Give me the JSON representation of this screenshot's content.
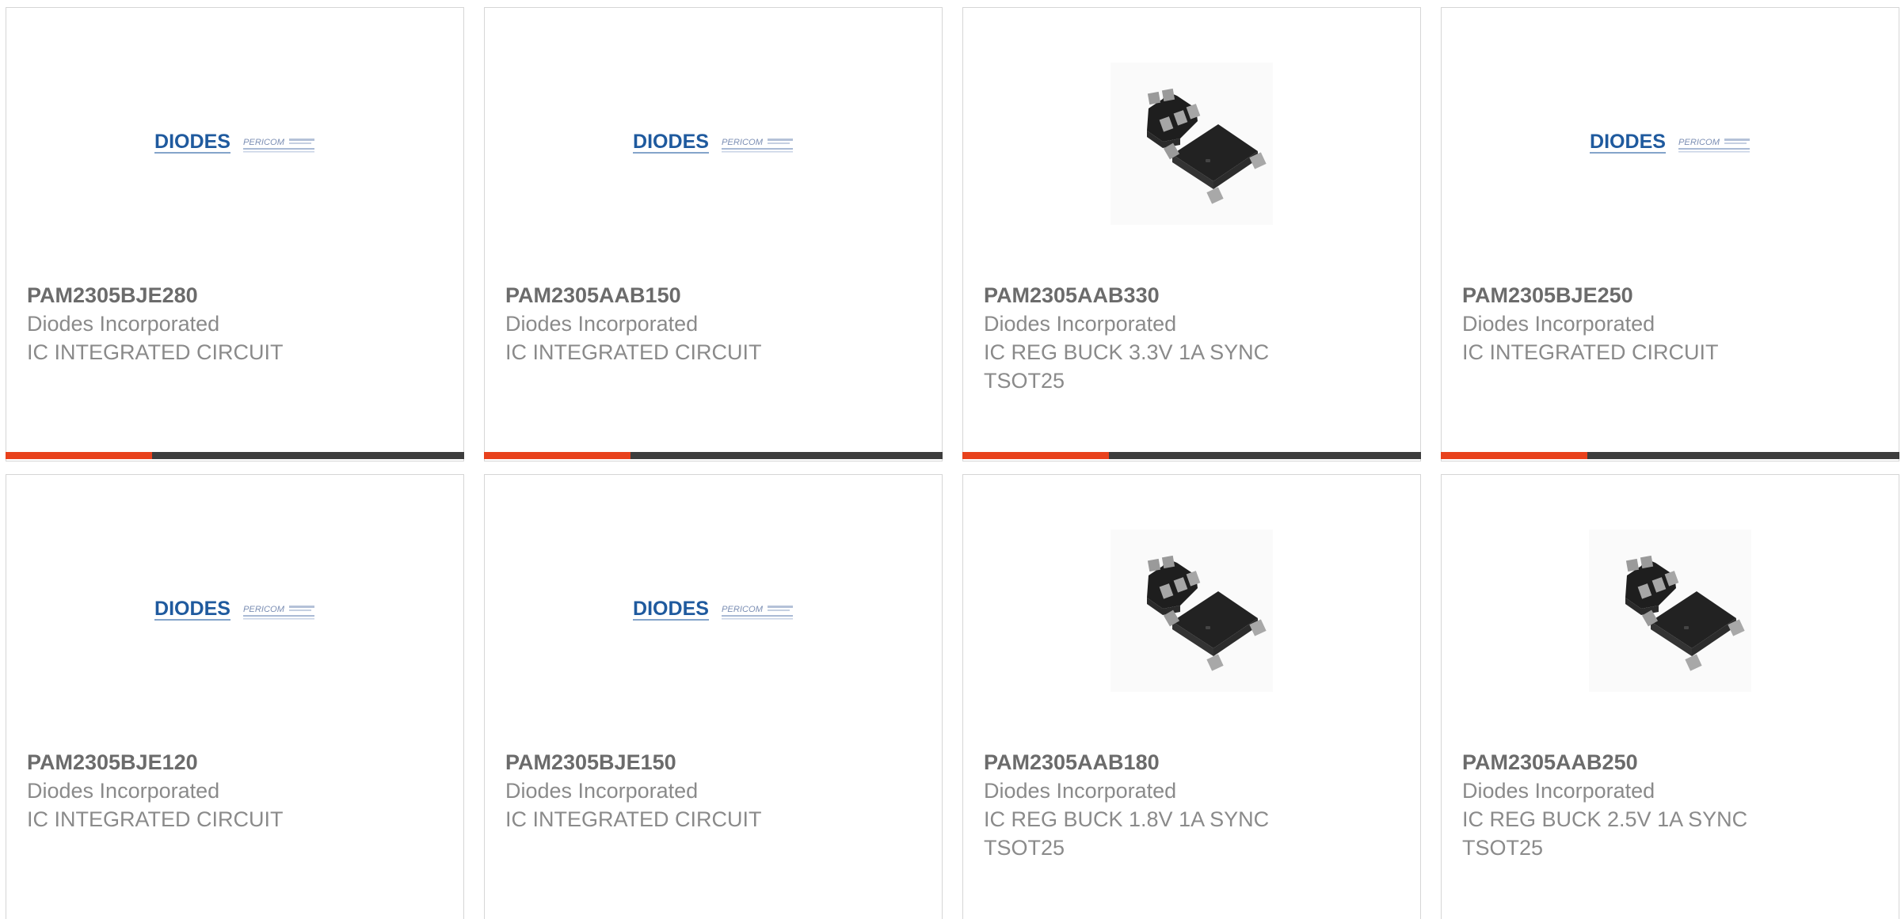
{
  "colors": {
    "accent": "#e8411c",
    "track": "#3d3d3d",
    "part_number": "#6b6b6b",
    "secondary_text": "#8a8a8a",
    "border": "#d6d6d6",
    "diodes_blue": "#1f5a9e"
  },
  "logo": {
    "brand": "DIODES",
    "sub_brand": "PERICOM"
  },
  "products": [
    {
      "part_number": "PAM2305BJE280",
      "manufacturer": "Diodes Incorporated",
      "description": "IC INTEGRATED CIRCUIT",
      "image": "diodes-pericom-logo",
      "progress": 0.32
    },
    {
      "part_number": "PAM2305AAB150",
      "manufacturer": "Diodes Incorporated",
      "description": "IC INTEGRATED CIRCUIT",
      "image": "diodes-pericom-logo",
      "progress": 0.32
    },
    {
      "part_number": "PAM2305AAB330",
      "manufacturer": "Diodes Incorporated",
      "description": "IC REG BUCK 3.3V 1A SYNC TSOT25",
      "image": "tsot25-chip-photo",
      "progress": 0.32
    },
    {
      "part_number": "PAM2305BJE250",
      "manufacturer": "Diodes Incorporated",
      "description": "IC INTEGRATED CIRCUIT",
      "image": "diodes-pericom-logo",
      "progress": 0.32
    },
    {
      "part_number": "PAM2305BJE120",
      "manufacturer": "Diodes Incorporated",
      "description": "IC INTEGRATED CIRCUIT",
      "image": "diodes-pericom-logo"
    },
    {
      "part_number": "PAM2305BJE150",
      "manufacturer": "Diodes Incorporated",
      "description": "IC INTEGRATED CIRCUIT",
      "image": "diodes-pericom-logo"
    },
    {
      "part_number": "PAM2305AAB180",
      "manufacturer": "Diodes Incorporated",
      "description": "IC REG BUCK 1.8V 1A SYNC TSOT25",
      "image": "tsot25-chip-photo"
    },
    {
      "part_number": "PAM2305AAB250",
      "manufacturer": "Diodes Incorporated",
      "description": "IC REG BUCK 2.5V 1A SYNC TSOT25",
      "image": "tsot25-chip-photo"
    }
  ]
}
